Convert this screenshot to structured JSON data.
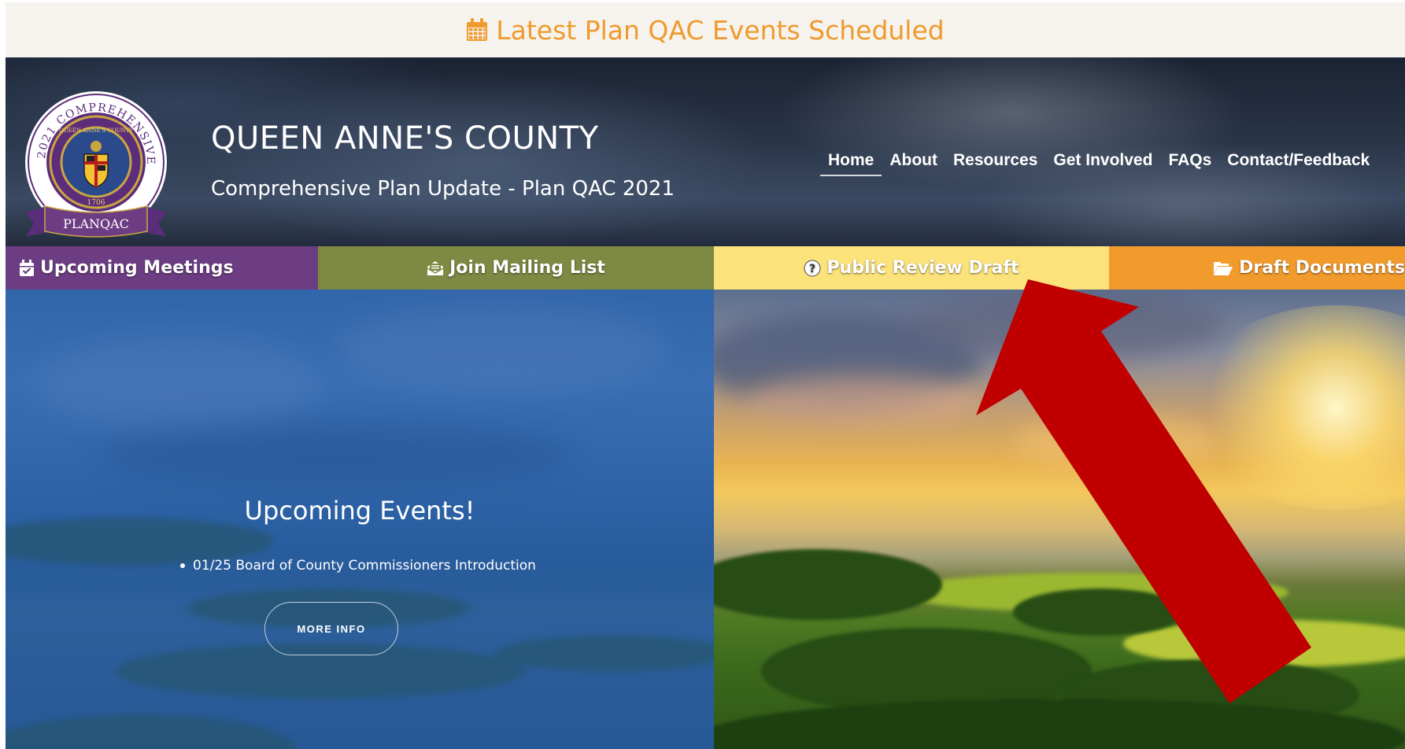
{
  "banner": {
    "icon": "calendar-icon",
    "text": "Latest Plan QAC Events Scheduled",
    "color": "#ef9a2c"
  },
  "header": {
    "logo": {
      "ring_text": "2021 COMPREHENSIVE PLAN",
      "inner_text": "QUEEN ANNE'S COUNTY",
      "year": "1706",
      "ribbon": "PLANQAC"
    },
    "title": "QUEEN ANNE'S COUNTY",
    "subtitle": "Comprehensive Plan Update - Plan QAC 2021",
    "nav": [
      {
        "label": "Home",
        "active": true
      },
      {
        "label": "About"
      },
      {
        "label": "Resources"
      },
      {
        "label": "Get Involved"
      },
      {
        "label": "FAQs"
      },
      {
        "label": "Contact/Feedback"
      }
    ]
  },
  "quickbar": [
    {
      "label": "Upcoming Meetings",
      "icon": "calendar-check-icon",
      "color": "#6d3d83"
    },
    {
      "label": "Join Mailing List",
      "icon": "envelope-open-icon",
      "color": "#7e8943"
    },
    {
      "label": "Public Review Draft",
      "icon": "question-circle-icon",
      "color": "#fbe27a"
    },
    {
      "label": "Draft Documents",
      "icon": "folder-open-icon",
      "color": "#f29b2d"
    }
  ],
  "events": {
    "title": "Upcoming Events!",
    "items": [
      "01/25 Board of County Commissioners Introduction"
    ],
    "button": "MORE INFO"
  },
  "annotation": {
    "shape": "red-arrow",
    "color": "#c00000",
    "points_to": "Public Review Draft"
  }
}
